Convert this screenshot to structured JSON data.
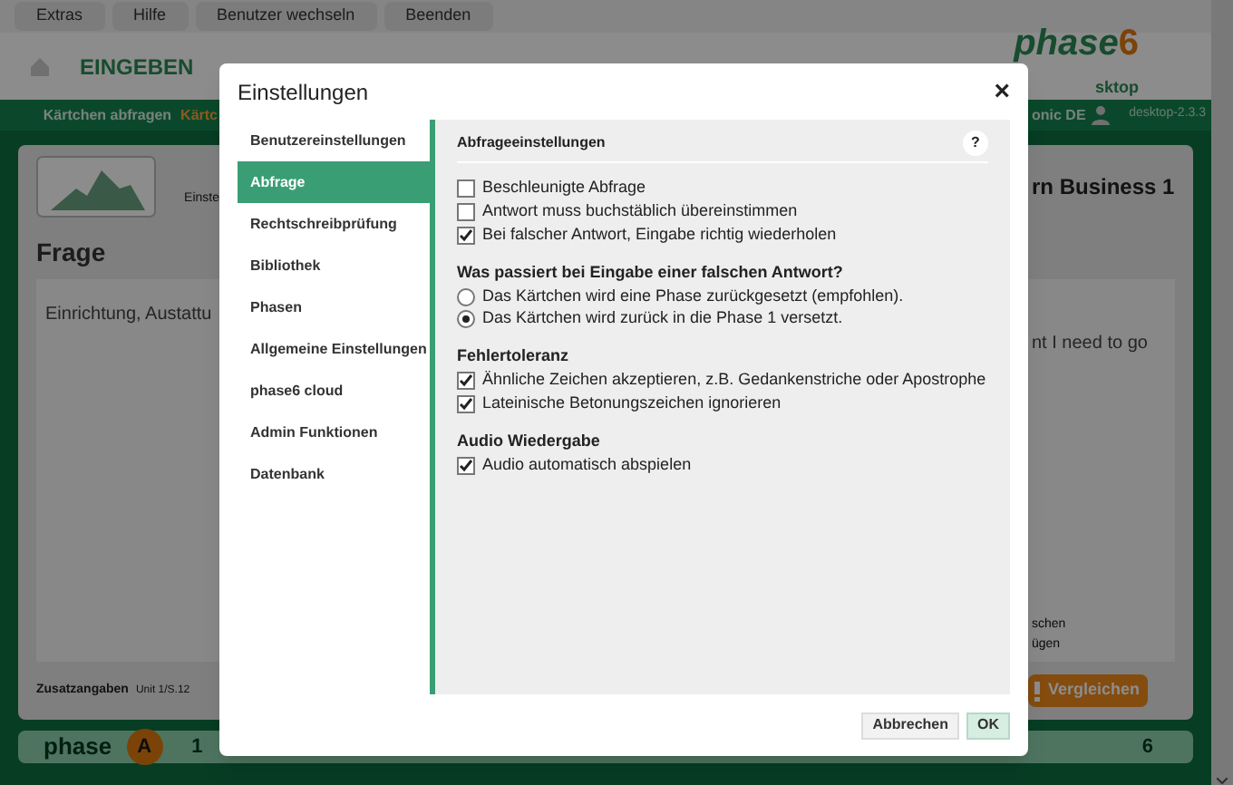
{
  "menu_bar": [
    "Extras",
    "Hilfe",
    "Benutzer wechseln",
    "Beenden"
  ],
  "header": {
    "mode": "EINGEBEN",
    "logo_word": "phase",
    "logo_digit": "6",
    "logo_sub": "sktop"
  },
  "nav_bar": {
    "items": [
      {
        "label": "Kärtchen abfragen",
        "selected": false
      },
      {
        "label": "Kärtc",
        "selected": true
      }
    ],
    "user": "onic DE",
    "version": "desktop-2.3.3"
  },
  "card": {
    "course_tab": "Einste",
    "course_title": "rn Business 1",
    "question_heading": "Frage",
    "question_text": "Einrichtung, Austattu",
    "answer_text": "nt I need to go",
    "option_1": "schen",
    "option_2": "ügen",
    "extra_label": "Zusatzangaben",
    "extra_value": "Unit 1/S.12",
    "compare_button": "Vergleichen"
  },
  "phase_bar": {
    "label": "phase",
    "badge": "A",
    "first": "1",
    "last": "6"
  },
  "dialog": {
    "title": "Einstellungen",
    "close": "×",
    "sidebar": [
      {
        "label": "Benutzereinstellungen",
        "selected": false
      },
      {
        "label": "Abfrage",
        "selected": true
      },
      {
        "label": "Rechtschreibprüfung",
        "selected": false
      },
      {
        "label": "Bibliothek",
        "selected": false
      },
      {
        "label": "Phasen",
        "selected": false
      },
      {
        "label": "Allgemeine Einstellungen",
        "selected": false
      },
      {
        "label": "phase6 cloud",
        "selected": false
      },
      {
        "label": "Admin Funktionen",
        "selected": false
      },
      {
        "label": "Datenbank",
        "selected": false
      }
    ],
    "panel_title": "Abfrageeinstellungen",
    "help": "?",
    "sections": [
      {
        "options": [
          {
            "kind": "checkbox",
            "label": "Beschleunigte Abfrage",
            "checked": false
          },
          {
            "kind": "checkbox",
            "label": "Antwort muss buchstäblich übereinstimmen",
            "checked": false
          },
          {
            "kind": "checkbox",
            "label": "Bei falscher Antwort, Eingabe richtig wiederholen",
            "checked": true
          }
        ]
      },
      {
        "heading": "Was passiert bei Eingabe einer falschen Antwort?",
        "options": [
          {
            "kind": "radio",
            "label": "Das Kärtchen wird eine Phase zurückgesetzt (empfohlen).",
            "selected": false
          },
          {
            "kind": "radio",
            "label": "Das Kärtchen wird zurück in die Phase 1 versetzt.",
            "selected": true
          }
        ]
      },
      {
        "heading": "Fehlertoleranz",
        "options": [
          {
            "kind": "checkbox",
            "label": "Ähnliche Zeichen akzeptieren, z.B. Gedankenstriche oder Apostrophe",
            "checked": true
          },
          {
            "kind": "checkbox",
            "label": "Lateinische Betonungszeichen ignorieren",
            "checked": true
          }
        ]
      },
      {
        "heading": "Audio Wiedergabe",
        "options": [
          {
            "kind": "checkbox",
            "label": "Audio automatisch abspielen",
            "checked": true
          }
        ]
      }
    ],
    "buttons": [
      {
        "label": "Abbrechen",
        "kind": "secondary"
      },
      {
        "label": "OK",
        "kind": "primary"
      }
    ]
  }
}
